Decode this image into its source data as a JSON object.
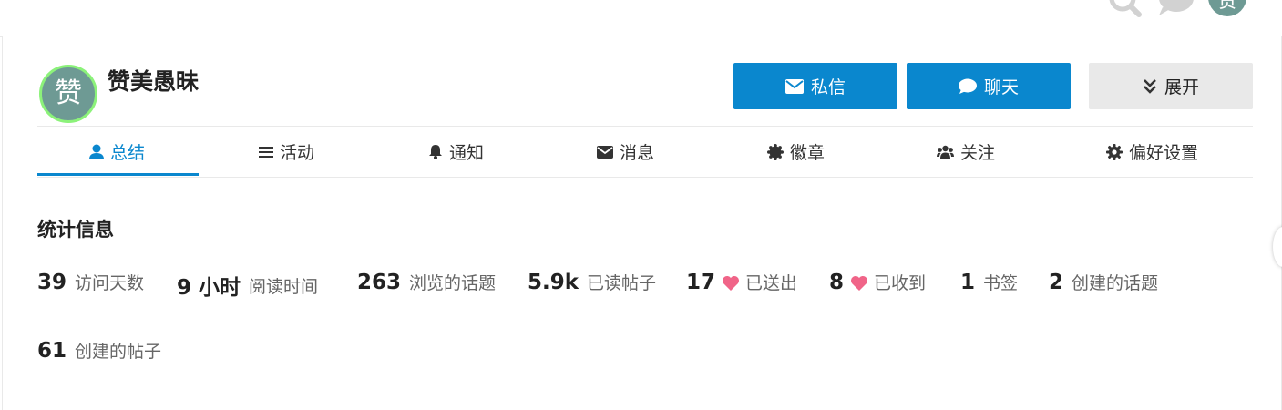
{
  "header": {
    "avatar_letter": "赞",
    "icons": [
      "search-icon",
      "chat-bubble-icon"
    ]
  },
  "profile": {
    "avatar_letter": "赞",
    "username": "赞美愚昧",
    "avatar_ring_color": "#8cf27a",
    "avatar_bg_color": "#6e9a94"
  },
  "actions": {
    "message_label": "私信",
    "chat_label": "聊天",
    "expand_label": "展开",
    "primary_color": "#0a87ce"
  },
  "nav": {
    "tabs": [
      {
        "label": "总结",
        "icon": "user-icon",
        "active": true
      },
      {
        "label": "活动",
        "icon": "list-icon"
      },
      {
        "label": "通知",
        "icon": "bell-icon"
      },
      {
        "label": "消息",
        "icon": "envelope-icon"
      },
      {
        "label": "徽章",
        "icon": "badge-icon"
      },
      {
        "label": "关注",
        "icon": "users-icon"
      },
      {
        "label": "偏好设置",
        "icon": "gear-icon"
      }
    ]
  },
  "stats": {
    "title": "统计信息",
    "items": [
      {
        "value": "39",
        "label": "访问天数"
      },
      {
        "value": "9 小时",
        "label": "阅读时间"
      },
      {
        "value": "263",
        "label": "浏览的话题"
      },
      {
        "value": "5.9k",
        "label": "已读帖子"
      },
      {
        "value": "17",
        "label": "已送出",
        "icon": "heart-icon"
      },
      {
        "value": "8",
        "label": "已收到",
        "icon": "heart-icon"
      },
      {
        "value": "1",
        "label": "书签"
      },
      {
        "value": "2",
        "label": "创建的话题"
      },
      {
        "value": "61",
        "label": "创建的帖子"
      }
    ],
    "heart_color": "#f06488"
  }
}
